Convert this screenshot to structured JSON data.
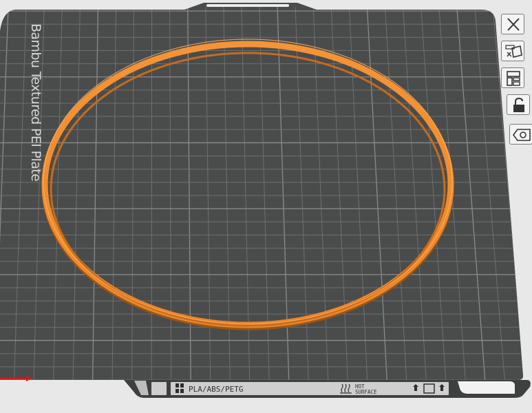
{
  "plate": {
    "name": "Bambu Textured PEI Plate",
    "filament_label": "PLA/ABS/PETG",
    "warning_line1": "HOT",
    "warning_line2": "SURFACE"
  },
  "toolbar": {
    "buttons": [
      {
        "name": "close-button",
        "icon": "close-icon"
      },
      {
        "name": "arrange-button",
        "icon": "auto-arrange-icon"
      },
      {
        "name": "orient-button",
        "icon": "layout-icon"
      },
      {
        "name": "lock-button",
        "icon": "lock-icon"
      },
      {
        "name": "view-button",
        "icon": "eye-icon"
      }
    ]
  },
  "colors": {
    "plate": "#4a4c4c",
    "grid": "#6e7171",
    "grid_major": "#8a8d8d",
    "object": "#f08a2c",
    "object_dark": "#b85f14",
    "background": "#e8e8e8",
    "axis_x": "#e01515"
  },
  "object": {
    "shape": "ring",
    "material_color_name": "orange"
  }
}
